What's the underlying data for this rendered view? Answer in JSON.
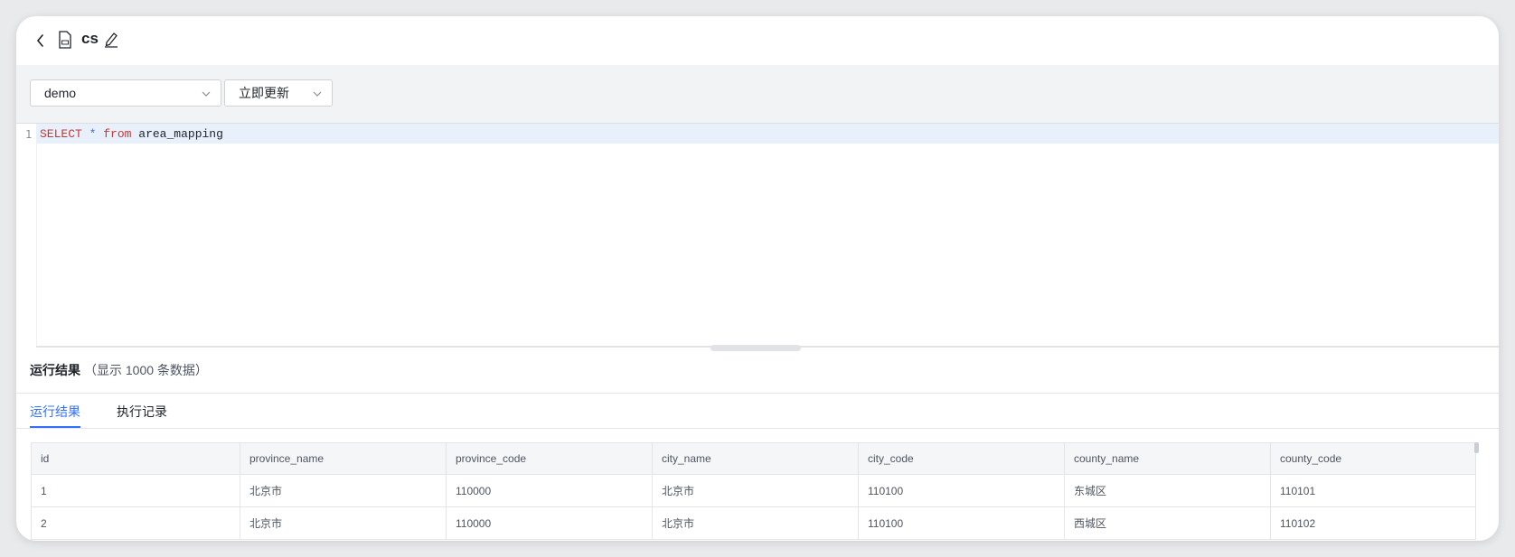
{
  "header": {
    "title": "cs",
    "icons": {
      "back": "chevron-left-icon",
      "file": "sql-file-icon",
      "edit": "pencil-icon"
    }
  },
  "toolbar": {
    "database_select": {
      "value": "demo"
    },
    "mode_select": {
      "value": "立即更新"
    }
  },
  "editor": {
    "line_numbers": [
      "1"
    ],
    "code_tokens": {
      "kw1": "SELECT",
      "op": "*",
      "kw2": "from",
      "ident": "area_mapping"
    }
  },
  "results": {
    "title": "运行结果",
    "subtitle": "（显示 1000 条数据）",
    "tabs": [
      {
        "label": "运行结果",
        "active": true
      },
      {
        "label": "执行记录",
        "active": false
      }
    ],
    "columns": [
      "id",
      "province_name",
      "province_code",
      "city_name",
      "city_code",
      "county_name",
      "county_code"
    ],
    "rows": [
      [
        "1",
        "北京市",
        "110000",
        "北京市",
        "110100",
        "东城区",
        "110101"
      ],
      [
        "2",
        "北京市",
        "110000",
        "北京市",
        "110100",
        "西城区",
        "110102"
      ]
    ]
  },
  "colors": {
    "accent": "#3370ff",
    "keyword": "#c7372f",
    "active_line": "#e8f0fc"
  }
}
